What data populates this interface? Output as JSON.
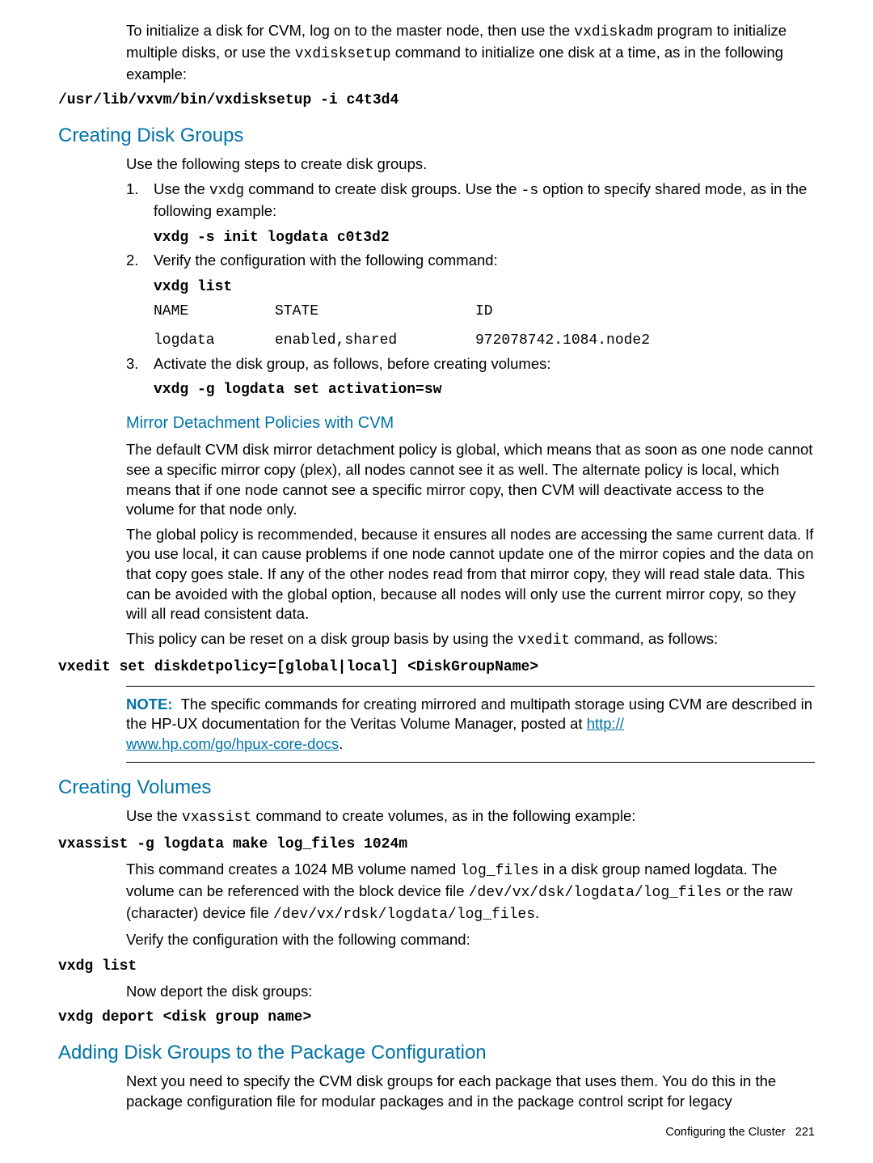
{
  "intro": "To initialize a disk for CVM, log on to the master node, then use the ",
  "intro_cmd1": "vxdiskadm",
  "intro2": " program to initialize multiple disks, or use the ",
  "intro_cmd2": "vxdisksetup",
  "intro3": " command to initialize one disk at a time, as in the following example:",
  "intro_example": "/usr/lib/vxvm/bin/vxdisksetup -i c4t3d4",
  "sec_dg": {
    "title": "Creating Disk Groups",
    "lead": "Use the following steps to create disk groups.",
    "step1a": "Use the ",
    "step1_cmd": "vxdg",
    "step1b": " command to create disk groups. Use the ",
    "step1_opt": "-s",
    "step1c": " option to specify shared mode, as in the following example:",
    "step1_ex": "vxdg -s init logdata c0t3d2",
    "step2": "Verify the configuration with the following command:",
    "step2_cmd": "vxdg list",
    "table_head": [
      "NAME",
      "STATE",
      "ID"
    ],
    "table_row": [
      "logdata",
      "enabled,shared",
      "972078742.1084.node2"
    ],
    "step3": "Activate the disk group, as follows, before creating volumes:",
    "step3_cmd": "vxdg -g logdata set activation=sw"
  },
  "mirror": {
    "title": "Mirror Detachment Policies with CVM",
    "p1": "The default CVM disk mirror detachment policy is global, which means that as soon as one node cannot see a specific mirror copy (plex), all nodes cannot see it as well. The alternate policy is local, which means that if one node cannot see a specific mirror copy, then CVM will deactivate access to the volume for that node only.",
    "p2": "The global policy is recommended, because it ensures all nodes are accessing the same current data. If you use local, it can cause problems if one node cannot update one of the mirror copies and the data on that copy goes stale. If any of the other nodes read from that mirror copy, they will read stale data. This can be avoided with the global option, because all nodes will only use the current mirror copy, so they will all read consistent data.",
    "p3a": "This policy can be reset on a disk group basis by using the ",
    "p3_cmd": "vxedit",
    "p3b": " command, as follows:",
    "cmd": "vxedit set diskdetpolicy=[global|local] <DiskGroupName>",
    "note_label": "NOTE:",
    "note_a": "The specific commands for creating mirrored and multipath storage using CVM are described in the HP-UX documentation for the Veritas Volume Manager, posted at ",
    "note_link1": "http://",
    "note_link2": "www.hp.com/go/hpux-core-docs",
    "note_b": "."
  },
  "vol": {
    "title": "Creating Volumes",
    "lead_a": "Use the ",
    "lead_cmd": "vxassist",
    "lead_b": " command to create volumes, as in the following example:",
    "cmd1": "vxassist -g logdata make log_files 1024m",
    "p2a": "This command creates a 1024 MB volume named ",
    "p2_cmd1": "log_files",
    "p2b": " in a disk group named logdata. The volume can be referenced with the block device file ",
    "p2_cmd2": "/dev/vx/dsk/logdata/log_files",
    "p2c": " or the raw (character) device file ",
    "p2_cmd3": "/dev/vx/rdsk/logdata/log_files",
    "p2d": ".",
    "p3": "Verify the configuration with the following command:",
    "cmd2": "vxdg list",
    "p4": "Now deport the disk groups:",
    "cmd3": "vxdg deport <disk group name>"
  },
  "pkg": {
    "title": "Adding Disk Groups to the Package Configuration",
    "p1": "Next you need to specify the CVM disk groups for each package that uses them. You do this in the package configuration file for modular packages and in the package control script for legacy"
  },
  "footer_a": "Configuring the Cluster",
  "footer_b": "221"
}
